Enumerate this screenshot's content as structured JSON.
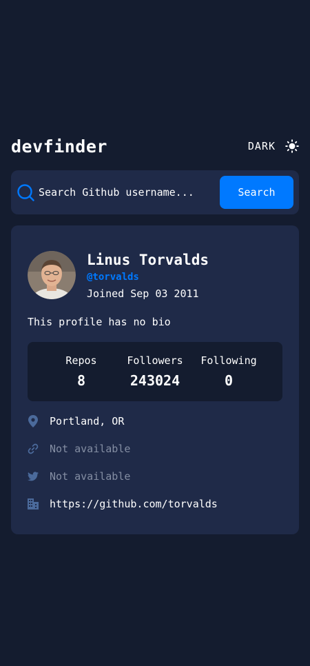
{
  "header": {
    "logo": "devfinder",
    "theme_label": "DARK",
    "theme_icon": "sun-icon"
  },
  "search": {
    "placeholder": "Search Github username...",
    "button_label": "Search",
    "icon": "search-icon"
  },
  "profile": {
    "name": "Linus Torvalds",
    "login": "@torvalds",
    "joined": "Joined Sep 03 2011",
    "bio": "This profile has no bio",
    "avatar_alt": "avatar"
  },
  "stats": [
    {
      "label": "Repos",
      "value": "8"
    },
    {
      "label": "Followers",
      "value": "243024"
    },
    {
      "label": "Following",
      "value": "0"
    }
  ],
  "links": {
    "location": "Portland, OR",
    "blog": "Not available",
    "twitter": "Not available",
    "company": "https://github.com/torvalds"
  },
  "colors": {
    "background": "#141c2f",
    "card": "#1f2a48",
    "accent": "#0079ff",
    "muted": "#848ea3",
    "icon": "#4b6a9b"
  }
}
